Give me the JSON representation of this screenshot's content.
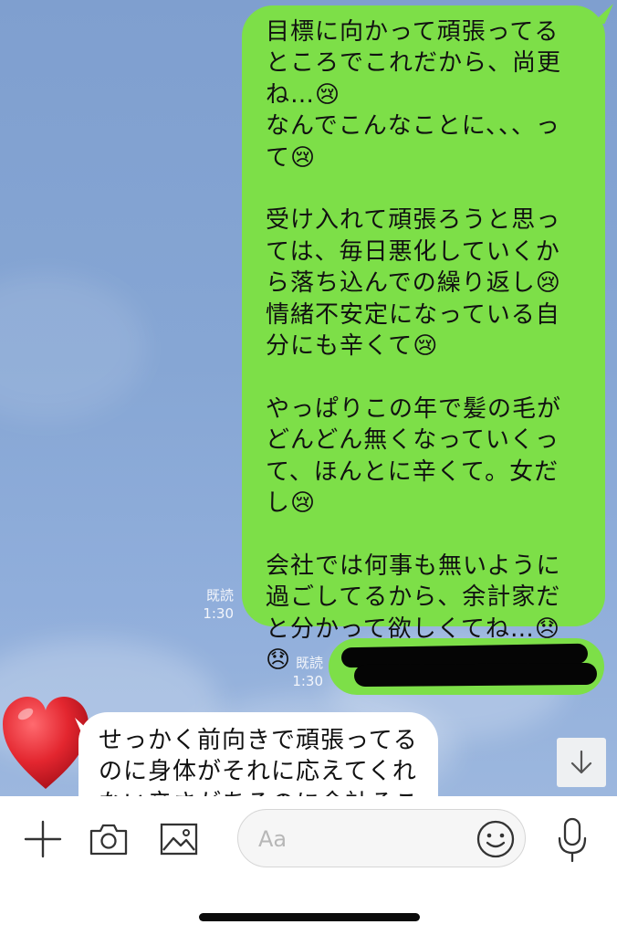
{
  "chat": {
    "outgoing_message": {
      "text": "目標に向かって頑張ってるところでこれだから、尚更ね…😢\nなんでこんなことに、、、って😢\n\n受け入れて頑張ろうと思っては、毎日悪化していくから落ち込んでの繰り返し😢\n情緒不安定になっている自分にも辛くて😢\n\nやっぱりこの年で髪の毛がどんどん無くなっていくって、ほんとに辛くて。女だし😢\n\n会社では何事も無いように過ごしてるから、余計家だと分かって欲しくてね…😞 😞",
      "read_label": "既読",
      "time": "1:30"
    },
    "redacted_message": {
      "read_label": "既読",
      "time": "1:30"
    },
    "incoming_message": {
      "text": "せっかく前向きで頑張ってるのに身体がそれに応えてくれない辛さがあるのに余計そこ"
    },
    "avatar_icon": "red-heart-icon"
  },
  "input_bar": {
    "placeholder": "Aa",
    "icons": [
      "plus-icon",
      "camera-icon",
      "image-icon",
      "emoji-icon",
      "microphone-icon"
    ]
  },
  "scroll_button_icon": "arrow-down-icon",
  "colors": {
    "outgoing_bubble": "#7ddf48",
    "chat_background": "#86a6d4",
    "incoming_bubble": "#ffffff",
    "heart": "#e3262f"
  }
}
